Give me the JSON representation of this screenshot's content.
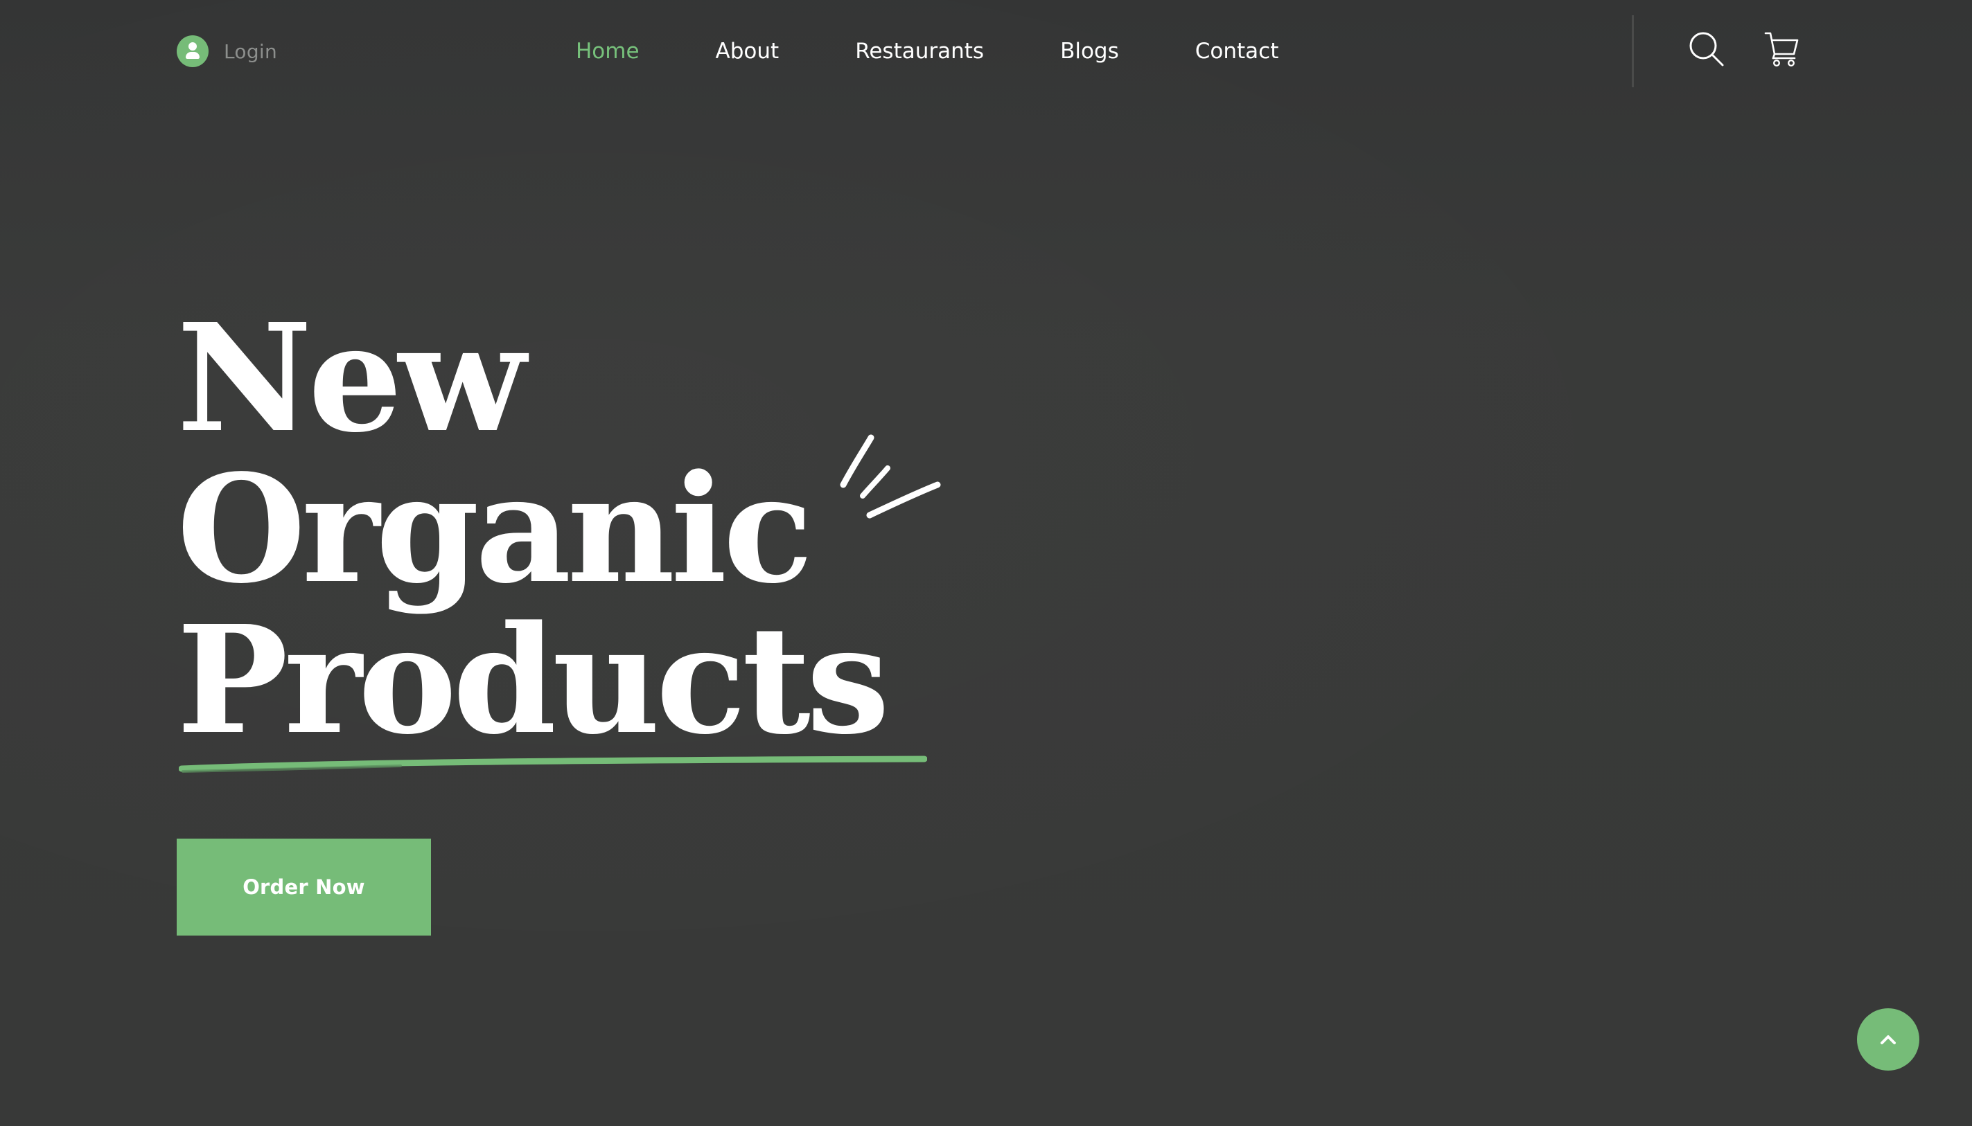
{
  "header": {
    "login_label": "Login",
    "nav": [
      {
        "label": "Home",
        "active": true
      },
      {
        "label": "About",
        "active": false
      },
      {
        "label": "Restaurants",
        "active": false
      },
      {
        "label": "Blogs",
        "active": false
      },
      {
        "label": "Contact",
        "active": false
      }
    ],
    "icons": {
      "login": "user-icon",
      "search": "search-icon",
      "cart": "cart-icon"
    }
  },
  "hero": {
    "title_lines": [
      "New",
      "Organic",
      "Products"
    ],
    "cta_label": "Order Now"
  },
  "scroll_top": {
    "icon": "chevron-up-icon"
  },
  "colors": {
    "background": "#383938",
    "accent": "#76bc78",
    "text": "#ffffff",
    "muted": "#8d8f8d"
  }
}
